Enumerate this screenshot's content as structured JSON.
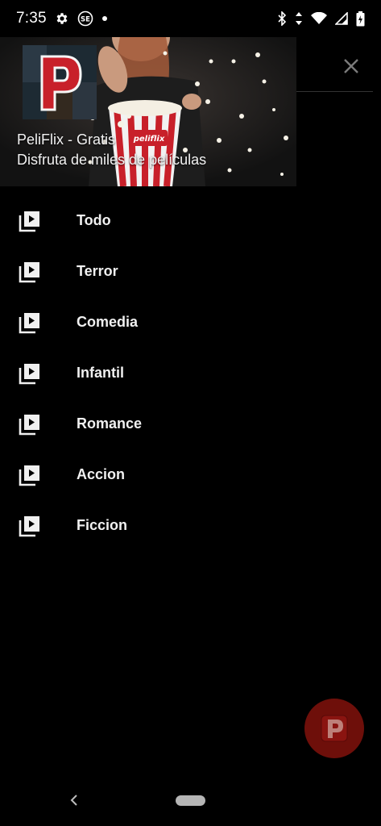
{
  "status_bar": {
    "time": "7:35",
    "left_icons": [
      "gear-icon",
      "sim-se-icon",
      "dot-icon"
    ],
    "right_icons": [
      "bluetooth-icon",
      "data-arrows-icon",
      "wifi-icon",
      "signal-icon",
      "battery-icon"
    ]
  },
  "drawer": {
    "header": {
      "title": "PeliFlix - Gratis",
      "subtitle": "Disfruta de miles de películas",
      "logo_letter": "P",
      "popcorn_brand": "peliflix"
    },
    "menu": [
      {
        "label": "Todo",
        "icon": "video-library-icon"
      },
      {
        "label": "Terror",
        "icon": "video-library-icon"
      },
      {
        "label": "Comedia",
        "icon": "video-library-icon"
      },
      {
        "label": "Infantil",
        "icon": "video-library-icon"
      },
      {
        "label": "Romance",
        "icon": "video-library-icon"
      },
      {
        "label": "Accion",
        "icon": "video-library-icon"
      },
      {
        "label": "Ficcion",
        "icon": "video-library-icon"
      }
    ]
  },
  "background": {
    "close_icon": "close-icon"
  },
  "fab": {
    "letter": "P",
    "color": "#6e0f0a"
  },
  "colors": {
    "brand_red": "#c8202a",
    "background": "#000000",
    "text": "#f0f0f0"
  }
}
